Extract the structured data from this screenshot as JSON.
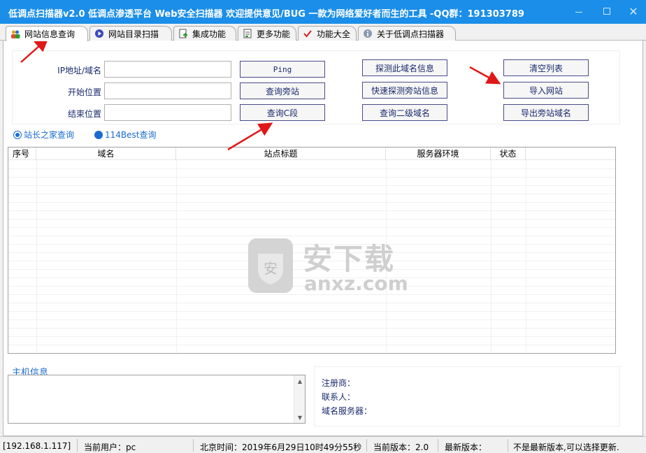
{
  "window": {
    "title": "低调点扫描器v2.0 低调点渗透平台 Web安全扫描器 欢迎提供意见/BUG 一款为网络爱好者而生的工具 -QQ群：191303789",
    "controls": [
      "minimize",
      "maximize",
      "close"
    ]
  },
  "tabs": [
    {
      "label": "网站信息查询",
      "icon": "users-icon",
      "active": true
    },
    {
      "label": "网站目录扫描",
      "icon": "play-circle-icon"
    },
    {
      "label": "集成功能",
      "icon": "document-add-icon"
    },
    {
      "label": "更多功能",
      "icon": "document-list-icon"
    },
    {
      "label": "功能大全",
      "icon": "checkmark-icon"
    },
    {
      "label": "关于低调点扫描器",
      "icon": "info-icon"
    }
  ],
  "form": {
    "ip_label": "IP地址/域名",
    "start_label": "开始位置",
    "end_label": "结束位置",
    "ip_value": "",
    "start_value": "",
    "end_value": ""
  },
  "buttons": {
    "ping": "Ping",
    "query_side": "查询旁站",
    "query_c": "查询C段",
    "probe_domain": "探测此域名信息",
    "fast_probe": "快速探测旁站信息",
    "query_sub": "查询二级域名",
    "clear_list": "清空列表",
    "import_site": "导入网站",
    "export_domains": "导出旁站域名"
  },
  "radios": [
    {
      "label": "站长之家查询",
      "selected": true
    },
    {
      "label": "114Best查询",
      "selected": false
    }
  ],
  "table": {
    "columns": [
      "序号",
      "域名",
      "站点标题",
      "服务器环境",
      "状态"
    ],
    "rows": []
  },
  "watermark": {
    "shield_char": "安",
    "cn": "安下载",
    "en": "anxz.com"
  },
  "host": {
    "title": "主机信息",
    "registrar_label": "注册商：",
    "contact_label": "联系人：",
    "dns_label": "域名服务器："
  },
  "status": {
    "ip": "[192.168.1.117]",
    "user": "当前用户：pc",
    "time": "北京时间：2019年6月29日10时49分55秒",
    "version": "当前版本：2.0",
    "latest": "最新版本：",
    "message": "不是最新版本,可以选择更新."
  },
  "colors": {
    "titlebar": "#1a8ee8",
    "label_text": "#1a2a6c",
    "radio_blue": "#1a6bd0",
    "annotation_arrow": "#e01818"
  }
}
